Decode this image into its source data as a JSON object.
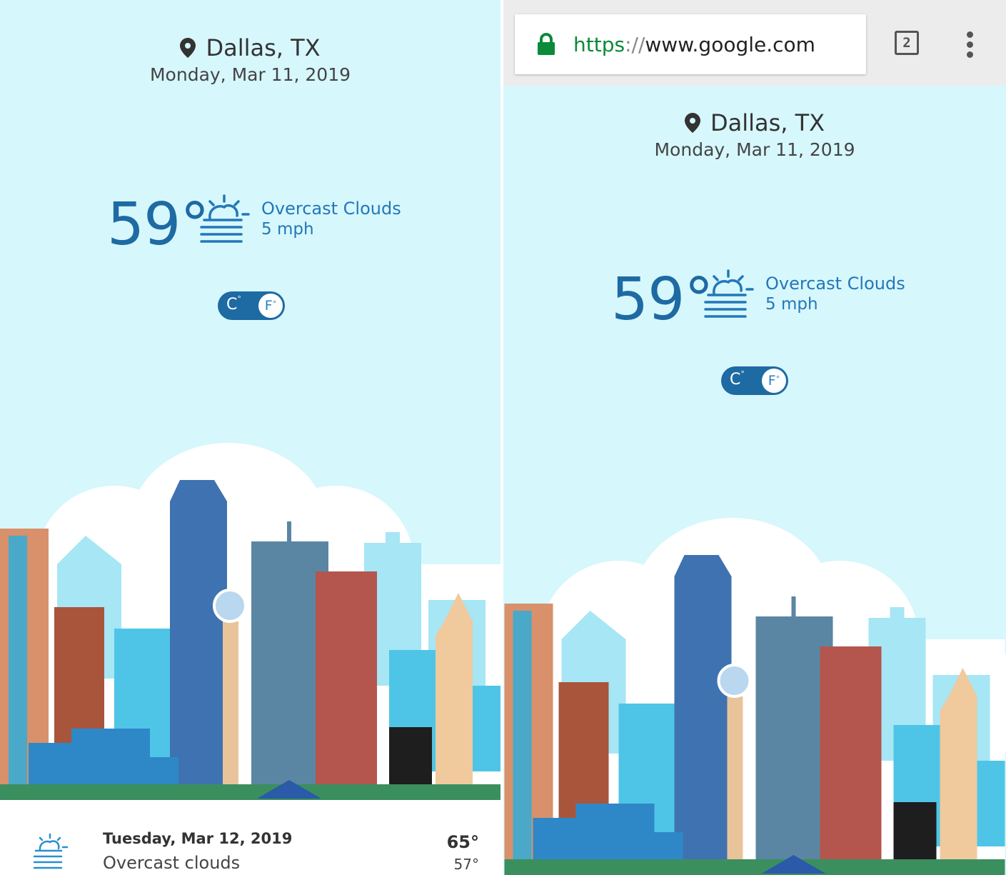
{
  "left": {
    "city": "Dallas, TX",
    "date": "Monday, Mar 11, 2019",
    "temp": "59°",
    "condition": "Overcast Clouds",
    "wind": "5 mph",
    "unit_toggle": {
      "c_label": "C",
      "f_label": "F",
      "selected": "F"
    },
    "forecast": {
      "day": "Tuesday, Mar 12, 2019",
      "condition": "Overcast clouds",
      "high": "65°",
      "low": "57°"
    }
  },
  "browser": {
    "url_scheme": "https",
    "url_sep": "://",
    "url_host": "www.google.com",
    "tab_count": "2"
  },
  "right": {
    "city": "Dallas, TX",
    "date": "Monday, Mar 11, 2019",
    "temp": "59°",
    "condition": "Overcast Clouds",
    "wind": "5 mph",
    "unit_toggle": {
      "c_label": "C",
      "f_label": "F",
      "selected": "F"
    }
  },
  "icons": {
    "location": "map-pin-icon",
    "weather": "sun-fog-icon",
    "lock": "lock-icon",
    "menu": "more-vert-icon"
  },
  "colors": {
    "sky": "#d6f7fc",
    "accent": "#1e6aa3",
    "lock": "#0b8a3a"
  }
}
